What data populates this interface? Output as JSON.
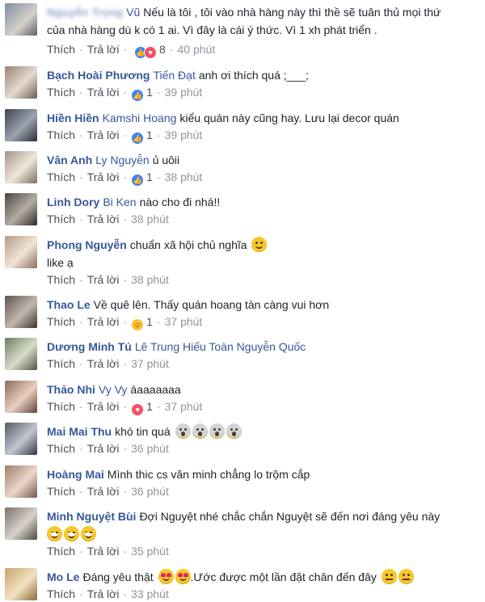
{
  "actions": {
    "like": "Thích",
    "reply": "Trả lời",
    "separator": "·"
  },
  "comments": [
    {
      "author": "Nguyễn Trọng",
      "tag": "Vũ",
      "lines": [
        "Nếu là tôi , tôi vào nhà hàng này thì thề sẽ tuân thủ mọi thứ",
        "của nhà hàng dù k có 1 ai. Vì đây là cái ý thức. Vì 1 xh phát triển ."
      ],
      "reactions": "8",
      "time": "40 phút"
    },
    {
      "author": "Bạch Hoài Phương",
      "tag": "Tiến Đạt",
      "text": "anh ơi thích quá ;___;",
      "reactions": "1",
      "time": "39 phút"
    },
    {
      "author": "Hiền Hiền",
      "tag": "Kamshi Hoang",
      "text": "kiểu quán này cũng hay. Lưu lại decor quán",
      "reactions": "1",
      "time": "39 phút"
    },
    {
      "author": "Vân Anh",
      "tag": "Ly Nguyễn",
      "text": "ủ uôii",
      "reactions": "1",
      "time": "38 phút"
    },
    {
      "author": "Linh Dory",
      "tag": "Bi Ken",
      "text": "nào cho đi nhá!!",
      "time": "38 phút"
    },
    {
      "author": "Phong Nguyễn",
      "text": "chuẩn xã hội chủ nghĩa",
      "text2": "like ạ",
      "time": "38 phút"
    },
    {
      "author": "Thao Le",
      "text": "Về quê lên. Thấy quán hoang tàn càng vui hơn",
      "reactions": "1",
      "time": "37 phút"
    },
    {
      "author": "Dương Minh Tú",
      "tag": "Lê Trung Hiếu Toàn Nguyễn Quốc",
      "time": "37 phút"
    },
    {
      "author": "Thảo Nhi",
      "tag": "Vy Vy",
      "text": "áaaaaaaa",
      "reactions": "1",
      "time": "37 phút"
    },
    {
      "author": "Mai Mai Thu",
      "text": "khó tin quá",
      "time": "36 phút"
    },
    {
      "author": "Hoàng Mai",
      "text": "Mình thic cs văn minh chẳng lo trộm cắp",
      "time": "36 phút"
    },
    {
      "author": "Minh Nguyệt Bùi",
      "text": "Đợi Nguyệt nhé chắc chắn Nguyệt sẽ đến nơi đáng yêu này",
      "time": "35 phút"
    },
    {
      "author": "Mo Le",
      "text": "Đáng yêu thật",
      "text_after": ".Ước được một lần đặt chân đến đây",
      "time": "33 phút"
    }
  ],
  "icons": {
    "like": "like-reaction-icon",
    "love": "love-reaction-icon",
    "haha": "haha-reaction-icon",
    "smile": "smile-emoji",
    "scream": "scream-emoji",
    "laugh": "laugh-tears-emoji",
    "hearteyes": "heart-eyes-emoji",
    "unamused": "unamused-emoji"
  },
  "colors": {
    "link": "#365899",
    "meta": "#90949c",
    "text": "#1d2129",
    "like": "#4080ff",
    "love": "#f25268"
  }
}
